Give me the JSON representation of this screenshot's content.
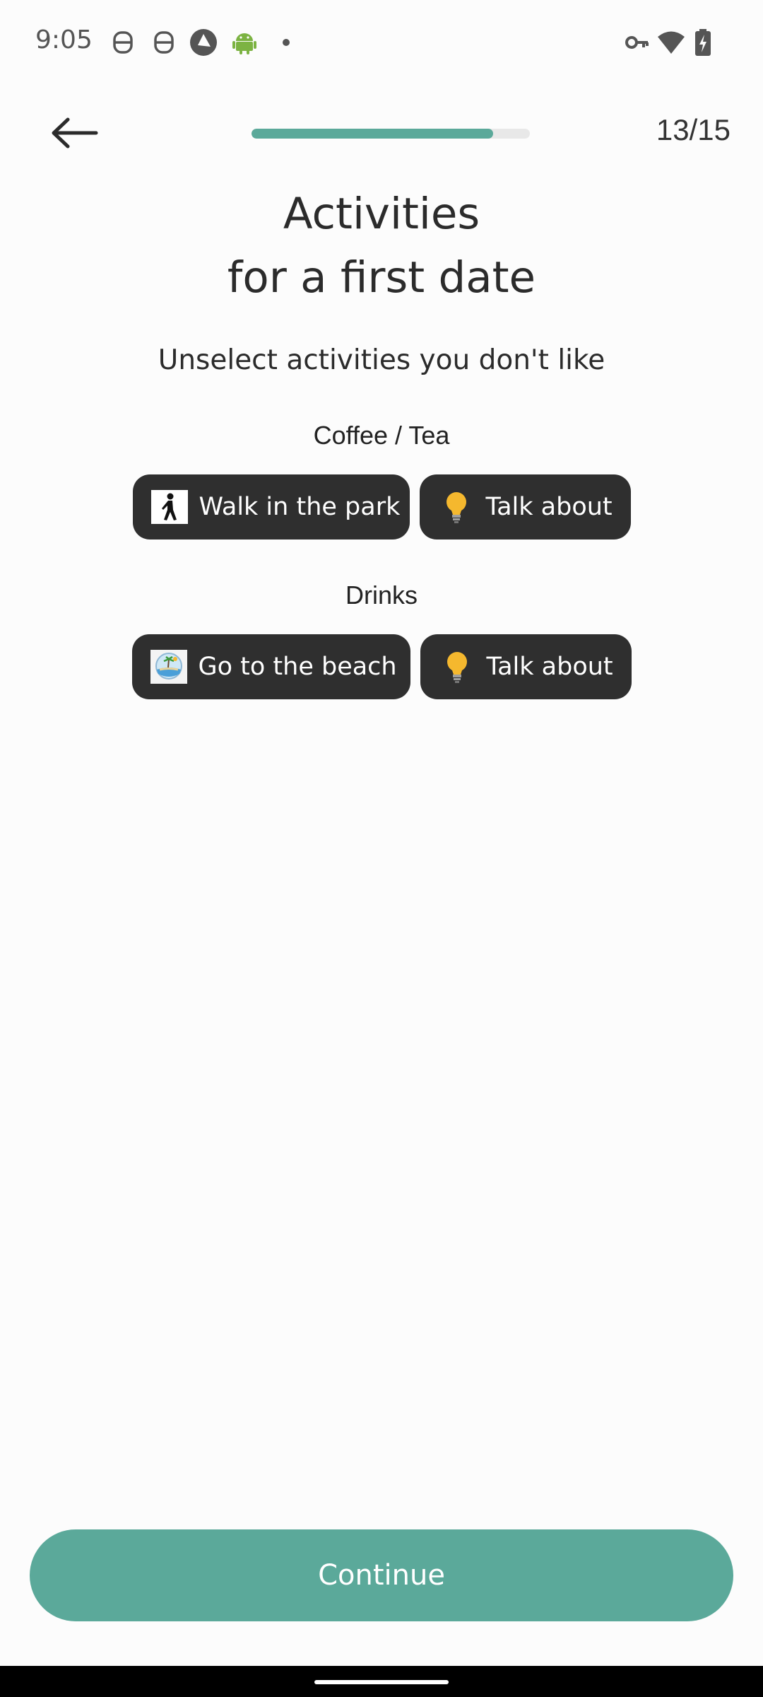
{
  "status_bar": {
    "time": "9:05",
    "icons": [
      "notification-s-icon",
      "notification-s-icon",
      "shutter-app-icon",
      "android-icon",
      "dot-icon",
      "vpn-key-icon",
      "wifi-icon",
      "battery-charging-icon"
    ]
  },
  "header": {
    "back_icon": "arrow-left-icon",
    "progress": 0.867,
    "step_counter": "13/15"
  },
  "title": {
    "line1": "Activities",
    "line2": "for a first date"
  },
  "subtitle": "Unselect activities you don't like",
  "sections": [
    {
      "label": "Coffee / Tea",
      "chips": [
        {
          "label": "Walk in the park",
          "icon": "pedestrian-icon"
        },
        {
          "label": "Talk about",
          "icon": "lightbulb-icon"
        }
      ]
    },
    {
      "label": "Drinks",
      "chips": [
        {
          "label": "Go to the beach",
          "icon": "beach-globe-icon"
        },
        {
          "label": "Talk about",
          "icon": "lightbulb-icon"
        }
      ]
    }
  ],
  "continue_button": {
    "label": "Continue"
  },
  "colors": {
    "accent": "#5ba99a",
    "chip_bg": "#2f2f2f",
    "background": "#fcfcfc"
  }
}
